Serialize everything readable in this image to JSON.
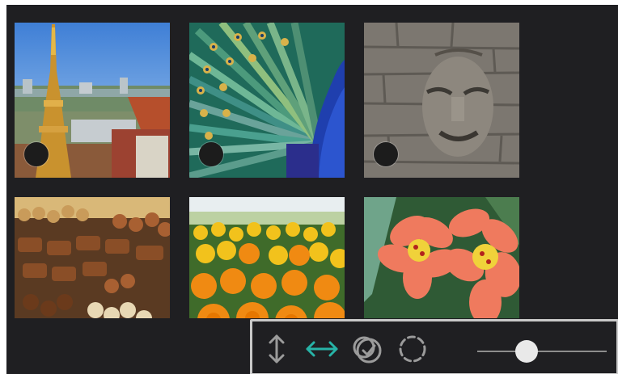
{
  "gallery": {
    "photos": [
      {
        "subject": "temple-spire-cityscape",
        "selectable": true
      },
      {
        "subject": "peacock-feathers",
        "selectable": true
      },
      {
        "subject": "stone-face-carving",
        "selectable": true
      },
      {
        "subject": "market-sweets",
        "selectable": false
      },
      {
        "subject": "marigold-flowers",
        "selectable": false
      },
      {
        "subject": "orange-lilies",
        "selectable": false
      }
    ]
  },
  "toolbar": {
    "tools": [
      {
        "icon": "vertical-resize-icon",
        "active": false
      },
      {
        "icon": "horizontal-resize-icon",
        "active": true
      },
      {
        "icon": "select-all-icon",
        "active": false
      },
      {
        "icon": "deselect-dashed-circle-icon",
        "active": false
      }
    ],
    "zoom_level": 0.38
  },
  "colors": {
    "active_accent": "#27b3a7",
    "icon_gray": "#9b9b9b",
    "background": "#1f1f22"
  }
}
